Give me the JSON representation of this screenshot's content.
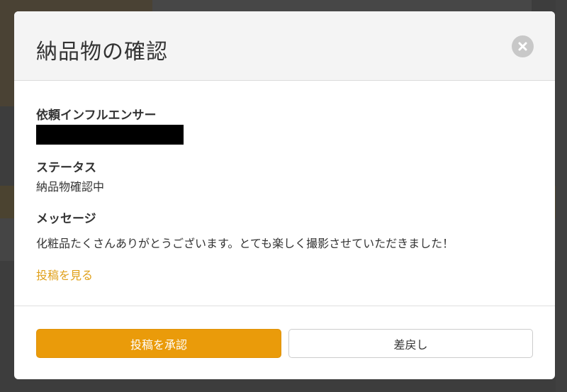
{
  "modal": {
    "title": "納品物の確認",
    "close_icon": "close-icon",
    "fields": {
      "influencer": {
        "label": "依頼インフルエンサー",
        "value_redacted": true
      },
      "status": {
        "label": "ステータス",
        "value": "納品物確認中"
      },
      "message": {
        "label": "メッセージ",
        "value": "化粧品たくさんありがとうございます。とても楽しく撮影させていただきました！"
      }
    },
    "view_post_link": "投稿を見る",
    "buttons": {
      "approve": "投稿を承認",
      "return": "差戻し"
    }
  },
  "colors": {
    "accent": "#ea9b0a",
    "link": "#e0a01a",
    "header_bg": "#f4f4f4",
    "overlay": "#3d3d3d"
  }
}
